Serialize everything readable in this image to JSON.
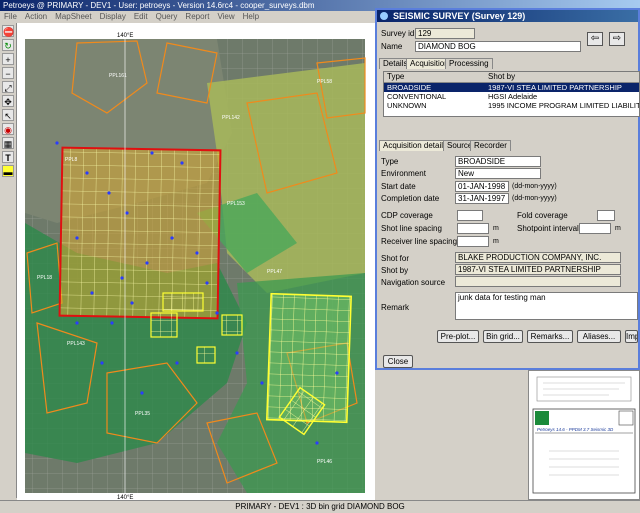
{
  "app": {
    "title": "Petroeys @ PRIMARY - DEV1 - User: petroeys - Version 14.6rc4 - cooper_surveys.dbm",
    "menu": [
      "File",
      "Action",
      "MapSheet",
      "Display",
      "Edit",
      "Query",
      "Report",
      "View",
      "Help"
    ],
    "status": "PRIMARY - DEV1 : 3D bin grid DIAMOND BOG"
  },
  "map": {
    "grid_label_top": "140°E",
    "grid_label_bottom": "140°E",
    "polygon_labels": [
      "PPL161",
      "PPL142",
      "PPL8",
      "PPL153",
      "PPL143",
      "PPL35",
      "PPL46",
      "PPL47",
      "PPL18",
      "PPL58"
    ]
  },
  "dialog": {
    "title": "SEISMIC SURVEY (Survey 129)",
    "survey_id_label": "Survey id",
    "survey_id": "129",
    "name_label": "Name",
    "name": "DIAMOND BOG",
    "tabs": [
      "Details",
      "Acquisition",
      "Processing"
    ],
    "list": {
      "headers": [
        "Type",
        "Shot by"
      ],
      "rows": [
        {
          "type": "BROADSIDE",
          "shot_by": "1987-VI STEA LIMITED PARTNERSHIP"
        },
        {
          "type": "CONVENTIONAL",
          "shot_by": "HGSI Adelaide"
        },
        {
          "type": "UNKNOWN",
          "shot_by": "1995 INCOME PROGRAM LIMITED LIABILITY C"
        }
      ]
    },
    "subtabs": [
      "Acquisition details",
      "Source",
      "Recorder"
    ],
    "fields": {
      "type_label": "Type",
      "type": "BROADSIDE",
      "environment_label": "Environment",
      "environment": "New",
      "start_label": "Start date",
      "start": "01-JAN-1998",
      "completion_label": "Completion date",
      "completion": "31-JAN-1997",
      "date_hint": "(dd-mon-yyyy)",
      "cdp_label": "CDP coverage",
      "fold_label": "Fold coverage",
      "shot_spacing_label": "Shot line spacing",
      "shotpoint_interval_label": "Shotpoint interval",
      "receiver_spacing_label": "Receiver line spacing",
      "unit_m": "m",
      "shot_for_label": "Shot for",
      "shot_for": "BLAKE PRODUCTION COMPANY, INC.",
      "shot_by_label": "Shot by",
      "shot_by": "1987-VI STEA LIMITED PARTNERSHIP",
      "nav_label": "Navigation source",
      "remark_label": "Remark",
      "remark": "junk data for testing man"
    },
    "buttons": {
      "preplot": "Pre-plot...",
      "bingrid": "Bin grid...",
      "remarks": "Remarks...",
      "aliases": "Aliases...",
      "import": "Impo",
      "close": "Close"
    }
  },
  "preview": {
    "title": "Petroeys 14.6 - PPDM 3.7 Seismic 3D"
  },
  "colors": {
    "dialog_border": "#5a7edc",
    "selection": "#0a246a",
    "grid_red": "#e01010",
    "grid_yellow": "#ffff33",
    "lease_orange": "#f08a1c"
  }
}
